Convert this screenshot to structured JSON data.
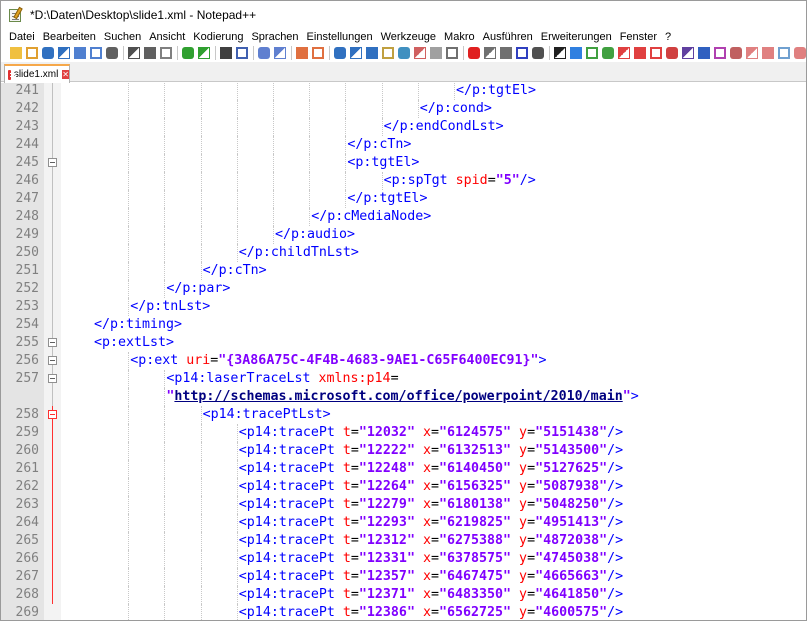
{
  "window": {
    "title": "*D:\\Daten\\Desktop\\slide1.xml - Notepad++"
  },
  "menu": {
    "items": [
      "Datei",
      "Bearbeiten",
      "Suchen",
      "Ansicht",
      "Kodierung",
      "Sprachen",
      "Einstellungen",
      "Werkzeuge",
      "Makro",
      "Ausführen",
      "Erweiterungen",
      "Fenster",
      "?"
    ]
  },
  "toolbar": {
    "icons": [
      "new-file-icon",
      "open-file-icon",
      "save-icon",
      "save-all-icon",
      "close-icon",
      "close-all-icon",
      "print-icon",
      "cut-icon",
      "copy-icon",
      "paste-icon",
      "undo-icon",
      "redo-icon",
      "find-icon",
      "replace-icon",
      "zoom-in-icon",
      "zoom-out-icon",
      "sync-vertical-icon",
      "sync-horizontal-icon",
      "word-wrap-icon",
      "show-all-chars-icon",
      "indent-guide-icon",
      "user-language-icon",
      "doc-map-icon",
      "function-list-icon",
      "folder-workspace-icon",
      "monitor-icon",
      "record-macro-icon",
      "stop-macro-icon",
      "play-macro-icon",
      "run-macro-multiple-icon",
      "save-macro-icon",
      "plugin-icon-1",
      "plugin-icon-2",
      "plugin-icon-3",
      "plugin-icon-4",
      "plugin-icon-5",
      "plugin-icon-6",
      "plugin-icon-7",
      "plugin-icon-8",
      "plugin-icon-9",
      "plugin-icon-10",
      "plugin-icon-11",
      "plugin-icon-12",
      "plugin-icon-13",
      "plugin-icon-14",
      "plugin-icon-15",
      "plugin-icon-16",
      "plugin-icon-17"
    ]
  },
  "tabs": [
    {
      "label": "slide1.xml",
      "active": true
    }
  ],
  "editor": {
    "lines": [
      {
        "num": "241",
        "indent": 11,
        "parts": [
          {
            "t": "</p:tgtEl>",
            "c": "tag"
          }
        ]
      },
      {
        "num": "242",
        "indent": 10,
        "parts": [
          {
            "t": "</p:cond>",
            "c": "tag"
          }
        ]
      },
      {
        "num": "243",
        "indent": 9,
        "parts": [
          {
            "t": "</p:endCondLst>",
            "c": "tag"
          }
        ]
      },
      {
        "num": "244",
        "indent": 8,
        "parts": [
          {
            "t": "</p:cTn>",
            "c": "tag"
          }
        ]
      },
      {
        "num": "245",
        "indent": 8,
        "parts": [
          {
            "t": "<p:tgtEl>",
            "c": "tag"
          }
        ]
      },
      {
        "num": "246",
        "indent": 9,
        "parts": [
          {
            "t": "<p:spTgt ",
            "c": "tag"
          },
          {
            "t": "spid",
            "c": "attr"
          },
          {
            "t": "=",
            "c": "op"
          },
          {
            "t": "\"5\"",
            "c": "val"
          },
          {
            "t": "/>",
            "c": "tag"
          }
        ]
      },
      {
        "num": "247",
        "indent": 8,
        "parts": [
          {
            "t": "</p:tgtEl>",
            "c": "tag"
          }
        ]
      },
      {
        "num": "248",
        "indent": 7,
        "parts": [
          {
            "t": "</p:cMediaNode>",
            "c": "tag"
          }
        ]
      },
      {
        "num": "249",
        "indent": 6,
        "parts": [
          {
            "t": "</p:audio>",
            "c": "tag"
          }
        ]
      },
      {
        "num": "250",
        "indent": 5,
        "parts": [
          {
            "t": "</p:childTnLst>",
            "c": "tag"
          }
        ]
      },
      {
        "num": "251",
        "indent": 4,
        "parts": [
          {
            "t": "</p:cTn>",
            "c": "tag"
          }
        ]
      },
      {
        "num": "252",
        "indent": 3,
        "parts": [
          {
            "t": "</p:par>",
            "c": "tag"
          }
        ]
      },
      {
        "num": "253",
        "indent": 2,
        "parts": [
          {
            "t": "</p:tnLst>",
            "c": "tag"
          }
        ]
      },
      {
        "num": "254",
        "indent": 1,
        "parts": [
          {
            "t": "</p:timing>",
            "c": "tag"
          }
        ]
      },
      {
        "num": "255",
        "indent": 1,
        "parts": [
          {
            "t": "<p:extLst>",
            "c": "tag"
          }
        ]
      },
      {
        "num": "256",
        "indent": 2,
        "parts": [
          {
            "t": "<p:ext ",
            "c": "tag"
          },
          {
            "t": "uri",
            "c": "attr"
          },
          {
            "t": "=",
            "c": "op"
          },
          {
            "t": "\"{3A86A75C-4F4B-4683-9AE1-C65F6400EC91}\"",
            "c": "val"
          },
          {
            "t": ">",
            "c": "tag"
          }
        ]
      },
      {
        "num": "257",
        "indent": 3,
        "parts": [
          {
            "t": "<p14:laserTraceLst ",
            "c": "tag"
          },
          {
            "t": "xmlns:p14",
            "c": "attr"
          },
          {
            "t": "=",
            "c": "op"
          }
        ]
      },
      {
        "num": "",
        "indent": 3,
        "parts": [
          {
            "t": "\"",
            "c": "val"
          },
          {
            "t": "http://schemas.microsoft.com/office/powerpoint/2010/main",
            "c": "url"
          },
          {
            "t": "\"",
            "c": "val"
          },
          {
            "t": ">",
            "c": "tag"
          }
        ]
      },
      {
        "num": "258",
        "indent": 4,
        "parts": [
          {
            "t": "<p14:tracePtLst>",
            "c": "tag"
          }
        ]
      },
      {
        "num": "259",
        "indent": 5,
        "parts": [
          {
            "t": "<p14:tracePt ",
            "c": "tag"
          },
          {
            "t": "t",
            "c": "attr"
          },
          {
            "t": "=",
            "c": "op"
          },
          {
            "t": "\"12032\"",
            "c": "val"
          },
          {
            "t": " x",
            "c": "attr"
          },
          {
            "t": "=",
            "c": "op"
          },
          {
            "t": "\"6124575\"",
            "c": "val"
          },
          {
            "t": " y",
            "c": "attr"
          },
          {
            "t": "=",
            "c": "op"
          },
          {
            "t": "\"5151438\"",
            "c": "val"
          },
          {
            "t": "/>",
            "c": "tag"
          }
        ]
      },
      {
        "num": "260",
        "indent": 5,
        "parts": [
          {
            "t": "<p14:tracePt ",
            "c": "tag"
          },
          {
            "t": "t",
            "c": "attr"
          },
          {
            "t": "=",
            "c": "op"
          },
          {
            "t": "\"12222\"",
            "c": "val"
          },
          {
            "t": " x",
            "c": "attr"
          },
          {
            "t": "=",
            "c": "op"
          },
          {
            "t": "\"6132513\"",
            "c": "val"
          },
          {
            "t": " y",
            "c": "attr"
          },
          {
            "t": "=",
            "c": "op"
          },
          {
            "t": "\"5143500\"",
            "c": "val"
          },
          {
            "t": "/>",
            "c": "tag"
          }
        ]
      },
      {
        "num": "261",
        "indent": 5,
        "parts": [
          {
            "t": "<p14:tracePt ",
            "c": "tag"
          },
          {
            "t": "t",
            "c": "attr"
          },
          {
            "t": "=",
            "c": "op"
          },
          {
            "t": "\"12248\"",
            "c": "val"
          },
          {
            "t": " x",
            "c": "attr"
          },
          {
            "t": "=",
            "c": "op"
          },
          {
            "t": "\"6140450\"",
            "c": "val"
          },
          {
            "t": " y",
            "c": "attr"
          },
          {
            "t": "=",
            "c": "op"
          },
          {
            "t": "\"5127625\"",
            "c": "val"
          },
          {
            "t": "/>",
            "c": "tag"
          }
        ]
      },
      {
        "num": "262",
        "indent": 5,
        "parts": [
          {
            "t": "<p14:tracePt ",
            "c": "tag"
          },
          {
            "t": "t",
            "c": "attr"
          },
          {
            "t": "=",
            "c": "op"
          },
          {
            "t": "\"12264\"",
            "c": "val"
          },
          {
            "t": " x",
            "c": "attr"
          },
          {
            "t": "=",
            "c": "op"
          },
          {
            "t": "\"6156325\"",
            "c": "val"
          },
          {
            "t": " y",
            "c": "attr"
          },
          {
            "t": "=",
            "c": "op"
          },
          {
            "t": "\"5087938\"",
            "c": "val"
          },
          {
            "t": "/>",
            "c": "tag"
          }
        ]
      },
      {
        "num": "263",
        "indent": 5,
        "parts": [
          {
            "t": "<p14:tracePt ",
            "c": "tag"
          },
          {
            "t": "t",
            "c": "attr"
          },
          {
            "t": "=",
            "c": "op"
          },
          {
            "t": "\"12279\"",
            "c": "val"
          },
          {
            "t": " x",
            "c": "attr"
          },
          {
            "t": "=",
            "c": "op"
          },
          {
            "t": "\"6180138\"",
            "c": "val"
          },
          {
            "t": " y",
            "c": "attr"
          },
          {
            "t": "=",
            "c": "op"
          },
          {
            "t": "\"5048250\"",
            "c": "val"
          },
          {
            "t": "/>",
            "c": "tag"
          }
        ]
      },
      {
        "num": "264",
        "indent": 5,
        "parts": [
          {
            "t": "<p14:tracePt ",
            "c": "tag"
          },
          {
            "t": "t",
            "c": "attr"
          },
          {
            "t": "=",
            "c": "op"
          },
          {
            "t": "\"12293\"",
            "c": "val"
          },
          {
            "t": " x",
            "c": "attr"
          },
          {
            "t": "=",
            "c": "op"
          },
          {
            "t": "\"6219825\"",
            "c": "val"
          },
          {
            "t": " y",
            "c": "attr"
          },
          {
            "t": "=",
            "c": "op"
          },
          {
            "t": "\"4951413\"",
            "c": "val"
          },
          {
            "t": "/>",
            "c": "tag"
          }
        ]
      },
      {
        "num": "265",
        "indent": 5,
        "parts": [
          {
            "t": "<p14:tracePt ",
            "c": "tag"
          },
          {
            "t": "t",
            "c": "attr"
          },
          {
            "t": "=",
            "c": "op"
          },
          {
            "t": "\"12312\"",
            "c": "val"
          },
          {
            "t": " x",
            "c": "attr"
          },
          {
            "t": "=",
            "c": "op"
          },
          {
            "t": "\"6275388\"",
            "c": "val"
          },
          {
            "t": " y",
            "c": "attr"
          },
          {
            "t": "=",
            "c": "op"
          },
          {
            "t": "\"4872038\"",
            "c": "val"
          },
          {
            "t": "/>",
            "c": "tag"
          }
        ]
      },
      {
        "num": "266",
        "indent": 5,
        "parts": [
          {
            "t": "<p14:tracePt ",
            "c": "tag"
          },
          {
            "t": "t",
            "c": "attr"
          },
          {
            "t": "=",
            "c": "op"
          },
          {
            "t": "\"12331\"",
            "c": "val"
          },
          {
            "t": " x",
            "c": "attr"
          },
          {
            "t": "=",
            "c": "op"
          },
          {
            "t": "\"6378575\"",
            "c": "val"
          },
          {
            "t": " y",
            "c": "attr"
          },
          {
            "t": "=",
            "c": "op"
          },
          {
            "t": "\"4745038\"",
            "c": "val"
          },
          {
            "t": "/>",
            "c": "tag"
          }
        ]
      },
      {
        "num": "267",
        "indent": 5,
        "parts": [
          {
            "t": "<p14:tracePt ",
            "c": "tag"
          },
          {
            "t": "t",
            "c": "attr"
          },
          {
            "t": "=",
            "c": "op"
          },
          {
            "t": "\"12357\"",
            "c": "val"
          },
          {
            "t": " x",
            "c": "attr"
          },
          {
            "t": "=",
            "c": "op"
          },
          {
            "t": "\"6467475\"",
            "c": "val"
          },
          {
            "t": " y",
            "c": "attr"
          },
          {
            "t": "=",
            "c": "op"
          },
          {
            "t": "\"4665663\"",
            "c": "val"
          },
          {
            "t": "/>",
            "c": "tag"
          }
        ]
      },
      {
        "num": "268",
        "indent": 5,
        "parts": [
          {
            "t": "<p14:tracePt ",
            "c": "tag"
          },
          {
            "t": "t",
            "c": "attr"
          },
          {
            "t": "=",
            "c": "op"
          },
          {
            "t": "\"12371\"",
            "c": "val"
          },
          {
            "t": " x",
            "c": "attr"
          },
          {
            "t": "=",
            "c": "op"
          },
          {
            "t": "\"6483350\"",
            "c": "val"
          },
          {
            "t": " y",
            "c": "attr"
          },
          {
            "t": "=",
            "c": "op"
          },
          {
            "t": "\"4641850\"",
            "c": "val"
          },
          {
            "t": "/>",
            "c": "tag"
          }
        ]
      },
      {
        "num": "269",
        "indent": 5,
        "parts": [
          {
            "t": "<p14:tracePt ",
            "c": "tag"
          },
          {
            "t": "t",
            "c": "attr"
          },
          {
            "t": "=",
            "c": "op"
          },
          {
            "t": "\"12386\"",
            "c": "val"
          },
          {
            "t": " x",
            "c": "attr"
          },
          {
            "t": "=",
            "c": "op"
          },
          {
            "t": "\"6562725\"",
            "c": "val"
          },
          {
            "t": " y",
            "c": "attr"
          },
          {
            "t": "=",
            "c": "op"
          },
          {
            "t": "\"4600575\"",
            "c": "val"
          },
          {
            "t": "/>",
            "c": "tag"
          }
        ]
      }
    ],
    "colors": {
      "tag": "#0000ff",
      "attr": "#ff0000",
      "val": "#8000ff",
      "url": "#000080",
      "gutter": "#e4e4e4",
      "fold_marker_active": "#ff3030"
    }
  }
}
